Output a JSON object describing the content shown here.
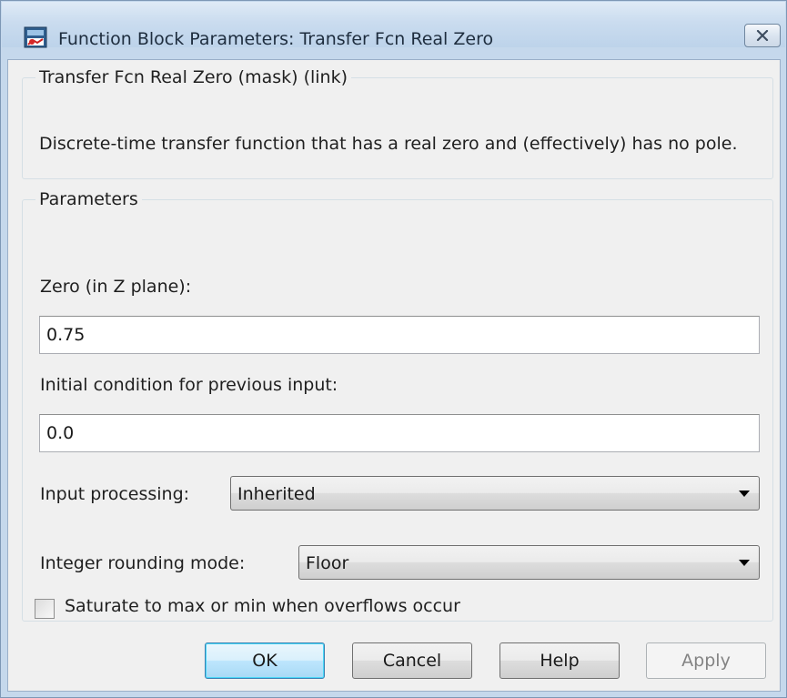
{
  "window": {
    "title": "Function Block Parameters: Transfer Fcn Real Zero",
    "close_glyph": "☒",
    "icon": "simulink-block-icon"
  },
  "description": {
    "legend": "Transfer Fcn Real Zero (mask) (link)",
    "text": "Discrete-time transfer function that has a real zero and (effectively) has no pole."
  },
  "parameters": {
    "legend": "Parameters",
    "zero": {
      "label": "Zero (in Z plane):",
      "value": "0.75"
    },
    "initial_condition": {
      "label": "Initial condition for previous input:",
      "value": "0.0"
    },
    "input_processing": {
      "label": "Input processing:",
      "value": "Inherited"
    },
    "rounding_mode": {
      "label": "Integer rounding mode:",
      "value": "Floor"
    },
    "saturate": {
      "label": "Saturate to max or min when overflows occur",
      "checked": false
    }
  },
  "buttons": {
    "ok": "OK",
    "cancel": "Cancel",
    "help": "Help",
    "apply": "Apply"
  },
  "colors": {
    "frame": "#c5d8ec",
    "client": "#f0f0f0",
    "default_button_border": "#3c7fb1"
  }
}
